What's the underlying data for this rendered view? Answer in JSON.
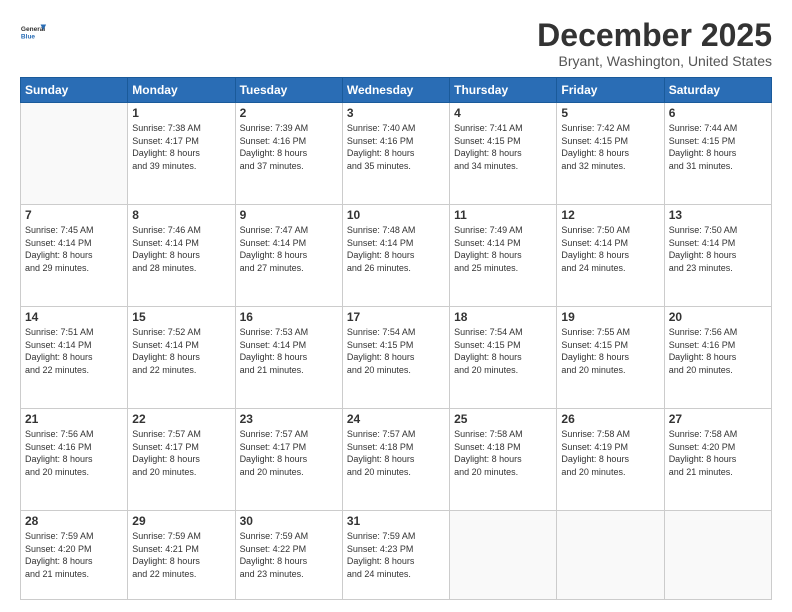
{
  "header": {
    "logo_line1": "General",
    "logo_line2": "Blue",
    "month_title": "December 2025",
    "location": "Bryant, Washington, United States"
  },
  "weekdays": [
    "Sunday",
    "Monday",
    "Tuesday",
    "Wednesday",
    "Thursday",
    "Friday",
    "Saturday"
  ],
  "weeks": [
    [
      {
        "day": "",
        "text": ""
      },
      {
        "day": "1",
        "text": "Sunrise: 7:38 AM\nSunset: 4:17 PM\nDaylight: 8 hours\nand 39 minutes."
      },
      {
        "day": "2",
        "text": "Sunrise: 7:39 AM\nSunset: 4:16 PM\nDaylight: 8 hours\nand 37 minutes."
      },
      {
        "day": "3",
        "text": "Sunrise: 7:40 AM\nSunset: 4:16 PM\nDaylight: 8 hours\nand 35 minutes."
      },
      {
        "day": "4",
        "text": "Sunrise: 7:41 AM\nSunset: 4:15 PM\nDaylight: 8 hours\nand 34 minutes."
      },
      {
        "day": "5",
        "text": "Sunrise: 7:42 AM\nSunset: 4:15 PM\nDaylight: 8 hours\nand 32 minutes."
      },
      {
        "day": "6",
        "text": "Sunrise: 7:44 AM\nSunset: 4:15 PM\nDaylight: 8 hours\nand 31 minutes."
      }
    ],
    [
      {
        "day": "7",
        "text": "Sunrise: 7:45 AM\nSunset: 4:14 PM\nDaylight: 8 hours\nand 29 minutes."
      },
      {
        "day": "8",
        "text": "Sunrise: 7:46 AM\nSunset: 4:14 PM\nDaylight: 8 hours\nand 28 minutes."
      },
      {
        "day": "9",
        "text": "Sunrise: 7:47 AM\nSunset: 4:14 PM\nDaylight: 8 hours\nand 27 minutes."
      },
      {
        "day": "10",
        "text": "Sunrise: 7:48 AM\nSunset: 4:14 PM\nDaylight: 8 hours\nand 26 minutes."
      },
      {
        "day": "11",
        "text": "Sunrise: 7:49 AM\nSunset: 4:14 PM\nDaylight: 8 hours\nand 25 minutes."
      },
      {
        "day": "12",
        "text": "Sunrise: 7:50 AM\nSunset: 4:14 PM\nDaylight: 8 hours\nand 24 minutes."
      },
      {
        "day": "13",
        "text": "Sunrise: 7:50 AM\nSunset: 4:14 PM\nDaylight: 8 hours\nand 23 minutes."
      }
    ],
    [
      {
        "day": "14",
        "text": "Sunrise: 7:51 AM\nSunset: 4:14 PM\nDaylight: 8 hours\nand 22 minutes."
      },
      {
        "day": "15",
        "text": "Sunrise: 7:52 AM\nSunset: 4:14 PM\nDaylight: 8 hours\nand 22 minutes."
      },
      {
        "day": "16",
        "text": "Sunrise: 7:53 AM\nSunset: 4:14 PM\nDaylight: 8 hours\nand 21 minutes."
      },
      {
        "day": "17",
        "text": "Sunrise: 7:54 AM\nSunset: 4:15 PM\nDaylight: 8 hours\nand 20 minutes."
      },
      {
        "day": "18",
        "text": "Sunrise: 7:54 AM\nSunset: 4:15 PM\nDaylight: 8 hours\nand 20 minutes."
      },
      {
        "day": "19",
        "text": "Sunrise: 7:55 AM\nSunset: 4:15 PM\nDaylight: 8 hours\nand 20 minutes."
      },
      {
        "day": "20",
        "text": "Sunrise: 7:56 AM\nSunset: 4:16 PM\nDaylight: 8 hours\nand 20 minutes."
      }
    ],
    [
      {
        "day": "21",
        "text": "Sunrise: 7:56 AM\nSunset: 4:16 PM\nDaylight: 8 hours\nand 20 minutes."
      },
      {
        "day": "22",
        "text": "Sunrise: 7:57 AM\nSunset: 4:17 PM\nDaylight: 8 hours\nand 20 minutes."
      },
      {
        "day": "23",
        "text": "Sunrise: 7:57 AM\nSunset: 4:17 PM\nDaylight: 8 hours\nand 20 minutes."
      },
      {
        "day": "24",
        "text": "Sunrise: 7:57 AM\nSunset: 4:18 PM\nDaylight: 8 hours\nand 20 minutes."
      },
      {
        "day": "25",
        "text": "Sunrise: 7:58 AM\nSunset: 4:18 PM\nDaylight: 8 hours\nand 20 minutes."
      },
      {
        "day": "26",
        "text": "Sunrise: 7:58 AM\nSunset: 4:19 PM\nDaylight: 8 hours\nand 20 minutes."
      },
      {
        "day": "27",
        "text": "Sunrise: 7:58 AM\nSunset: 4:20 PM\nDaylight: 8 hours\nand 21 minutes."
      }
    ],
    [
      {
        "day": "28",
        "text": "Sunrise: 7:59 AM\nSunset: 4:20 PM\nDaylight: 8 hours\nand 21 minutes."
      },
      {
        "day": "29",
        "text": "Sunrise: 7:59 AM\nSunset: 4:21 PM\nDaylight: 8 hours\nand 22 minutes."
      },
      {
        "day": "30",
        "text": "Sunrise: 7:59 AM\nSunset: 4:22 PM\nDaylight: 8 hours\nand 23 minutes."
      },
      {
        "day": "31",
        "text": "Sunrise: 7:59 AM\nSunset: 4:23 PM\nDaylight: 8 hours\nand 24 minutes."
      },
      {
        "day": "",
        "text": ""
      },
      {
        "day": "",
        "text": ""
      },
      {
        "day": "",
        "text": ""
      }
    ]
  ]
}
